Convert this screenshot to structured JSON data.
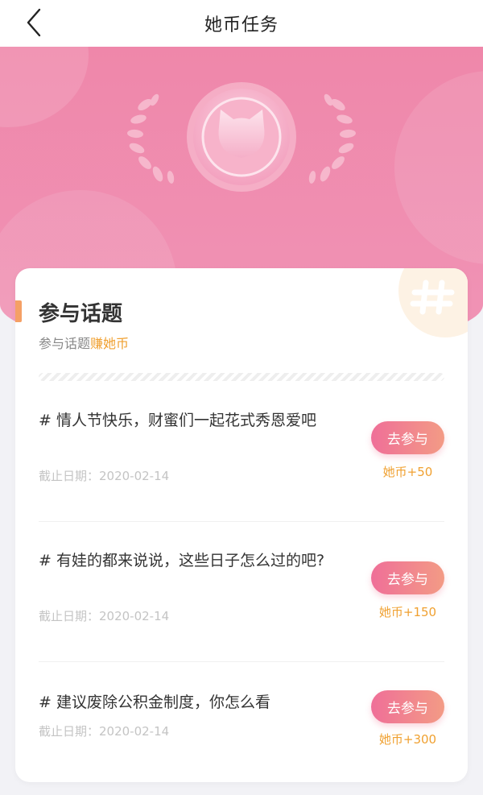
{
  "nav": {
    "title": "她币任务"
  },
  "section": {
    "title": "参与话题",
    "subtitle_prefix": "参与话题",
    "subtitle_highlight": "赚她币"
  },
  "topics": [
    {
      "title": "# 情人节快乐，财蜜们一起花式秀恩爱吧",
      "date": "截止日期：2020-02-14",
      "button": "去参与",
      "reward": "她币+50"
    },
    {
      "title": "# 有娃的都来说说，这些日子怎么过的吧?",
      "date": "截止日期：2020-02-14",
      "button": "去参与",
      "reward": "她币+150"
    },
    {
      "title": "# 建议废除公积金制度，你怎么看",
      "date": "截止日期：2020-02-14",
      "button": "去参与",
      "reward": "她币+300"
    }
  ],
  "colors": {
    "hero": "#ef87aa",
    "accent": "#f5a065",
    "reward": "#f0a030",
    "button": "#ef6f98"
  },
  "icons": {
    "back": "chevron-left-icon",
    "medal": "cat-coin-medal-icon",
    "badge": "hashtag-icon"
  }
}
